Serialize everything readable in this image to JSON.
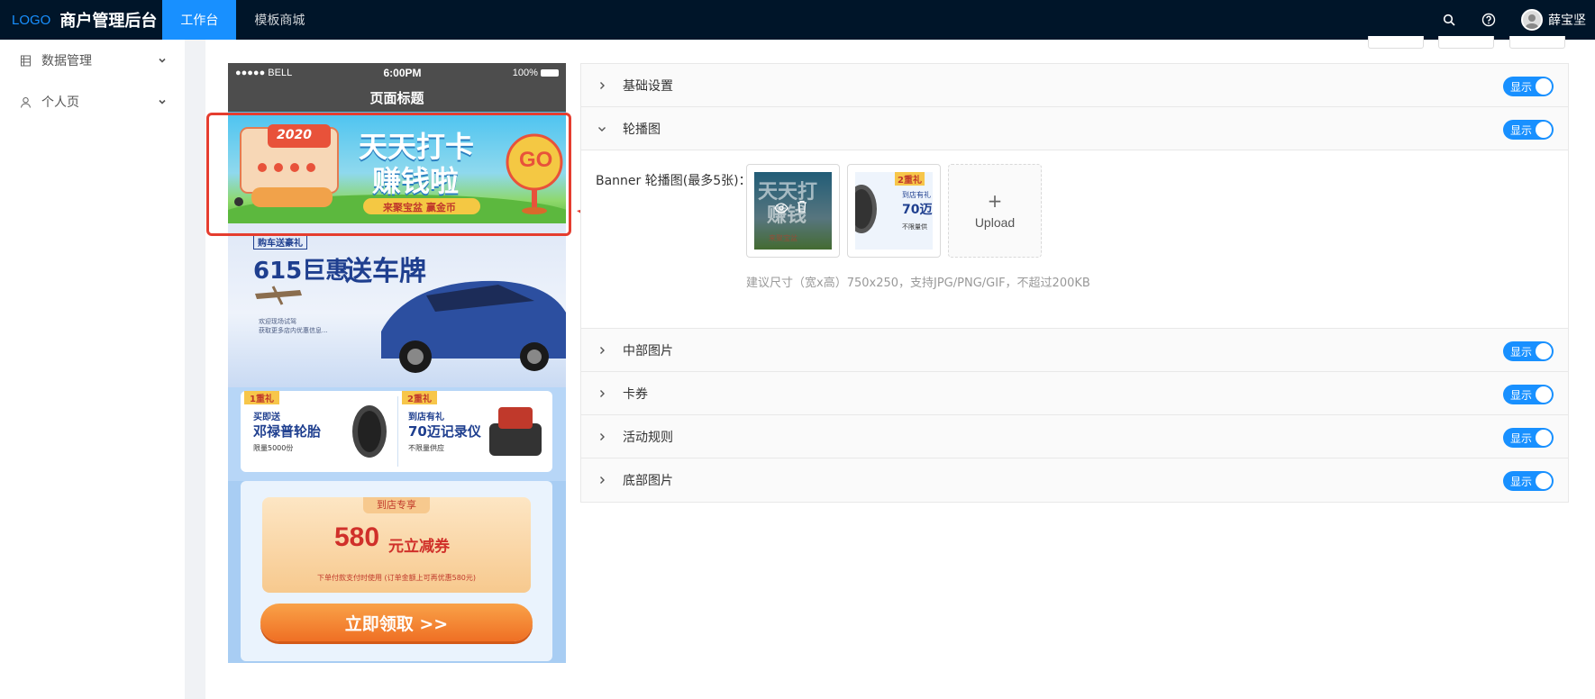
{
  "header": {
    "logo": "LOGO",
    "app_title": "商户管理后台",
    "tabs": [
      {
        "label": "工作台",
        "active": true
      },
      {
        "label": "模板商城",
        "active": false
      }
    ],
    "username": "薛宝坚",
    "icons": [
      "search-icon",
      "help-icon",
      "avatar"
    ]
  },
  "sidebar": {
    "items": [
      {
        "label": "数据管理",
        "icon": "table-icon"
      },
      {
        "label": "个人页",
        "icon": "user-icon"
      }
    ]
  },
  "phone": {
    "status": {
      "carrier": "●●●●● BELL",
      "time": "6:00PM",
      "battery": "100%"
    },
    "page_title": "页面标题",
    "banner1": {
      "year": "2020",
      "line1": "天天打卡",
      "line2": "赚钱啦",
      "go": "GO",
      "ribbon": "来聚宝盆 赢金币"
    },
    "banner2": {
      "tag": "购车送豪礼",
      "headline_a": "615巨惠",
      "headline_b": "送车牌",
      "note1": "欢迎现场试驾",
      "note2": "获取更多店内优惠信息..."
    },
    "gifts": [
      {
        "badge": "1重礼",
        "line1": "买即送",
        "line2": "邓禄普轮胎",
        "line3": "限量5000份"
      },
      {
        "badge": "2重礼",
        "line1": "到店有礼",
        "line2": "70迈记录仪",
        "line3": "不限量供应"
      }
    ],
    "coupon": {
      "tag": "到店专享",
      "amount": "580",
      "suffix": "元立减券",
      "note": "下单付款支付时使用 (订单金额上可再优惠580元)",
      "button": "立即领取 >>"
    }
  },
  "panel": {
    "toggle_label": "显示",
    "sections": [
      {
        "title": "基础设置",
        "expanded": false
      },
      {
        "title": "轮播图",
        "expanded": true
      },
      {
        "title": "中部图片",
        "expanded": false
      },
      {
        "title": "卡券",
        "expanded": false
      },
      {
        "title": "活动规则",
        "expanded": false
      },
      {
        "title": "底部图片",
        "expanded": false
      }
    ],
    "banner_field_label": "Banner 轮播图(最多5张)：",
    "upload_label": "Upload",
    "hint": "建议尺寸（宽x高）750x250，支持JPG/PNG/GIF，不超过200KB",
    "thumb2_text": {
      "badge": "2重礼",
      "line1": "到店有礼",
      "line2": "70迈",
      "line3": "不限量供"
    },
    "thumb1_text": {
      "line1": "天天打",
      "line2": "赚钱",
      "ribbon": "来聚宝盆"
    }
  },
  "colors": {
    "header_bg": "#001529",
    "accent": "#1890ff",
    "highlight": "#e53d2f"
  }
}
